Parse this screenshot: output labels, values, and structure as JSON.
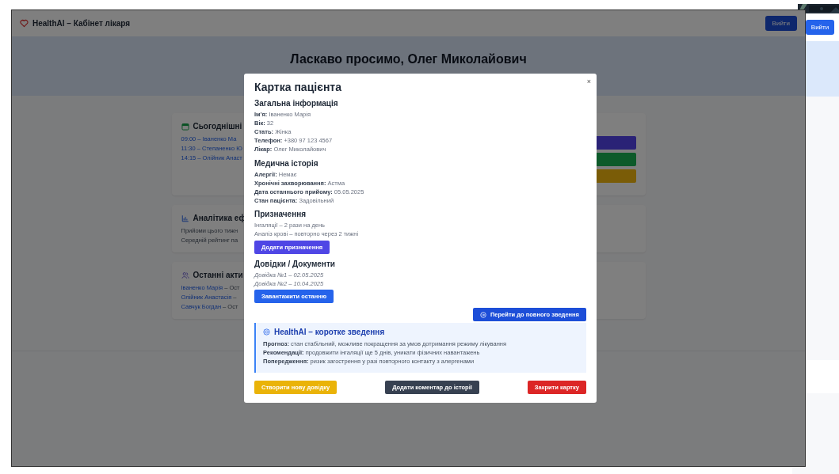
{
  "window": {
    "title": "HealthAI – Кабінет лікаря",
    "logout": "Вийти"
  },
  "hero": {
    "title": "Ласкаво просимо, Олег Миколайович"
  },
  "cards": [
    {
      "title": "Сьогоднішні",
      "items": [
        {
          "kind": "link",
          "text": "09:00 – Іваненко Ма"
        },
        {
          "kind": "link",
          "text": "11:30 – Степаненко Ю"
        },
        {
          "kind": "link",
          "text": "14:15 – Олійник Анаст"
        }
      ],
      "actions": [
        {
          "color": "#2a2276"
        },
        {
          "color": "#0d5a2a"
        },
        {
          "color": "#7a5c07"
        }
      ]
    },
    {
      "title": "Аналітика еф",
      "items": [
        {
          "kind": "plain",
          "text": "Прийоми цього тижн"
        },
        {
          "kind": "plain",
          "text": "Середній рейтинг па"
        }
      ]
    },
    {
      "title": "Останні акти",
      "items": [
        {
          "kind": "person",
          "name": "Іваненко Марія",
          "rest": "– Ост"
        },
        {
          "kind": "person",
          "name": "Олійник Анастасія",
          "rest": "–"
        },
        {
          "kind": "person",
          "name": "Савчук Богдан",
          "rest": "– Ост"
        }
      ]
    }
  ],
  "modal": {
    "title": "Картка пацієнта",
    "close": "×",
    "sections": [
      {
        "heading": "Загальна інформація",
        "kind": "fields",
        "fields": [
          {
            "label": "Ім'я:",
            "value": "Іваненко Марія"
          },
          {
            "label": "Вік:",
            "value": "32"
          },
          {
            "label": "Стать:",
            "value": "Жінка"
          },
          {
            "label": "Телефон:",
            "value": "+380 97 123 4567"
          },
          {
            "label": "Лікар:",
            "value": "Олег Миколайович"
          }
        ]
      },
      {
        "heading": "Медична історія",
        "kind": "fields",
        "fields": [
          {
            "label": "Алергії:",
            "value": "Немає"
          },
          {
            "label": "Хронічні захворювання:",
            "value": "Астма"
          },
          {
            "label": "Дата останнього прийому:",
            "value": "05.05.2025"
          },
          {
            "label": "Стан пацієнта:",
            "value": "Задовільний"
          }
        ]
      },
      {
        "heading": "Призначення",
        "kind": "lines",
        "lines": [
          "Інгаляції – 2 рази на день",
          "Аналіз крові – повторно через 2 тижні"
        ],
        "button": {
          "label": "Додати призначення",
          "color": "#4f46e5"
        }
      },
      {
        "heading": "Довідки / Документи",
        "kind": "docs",
        "lines": [
          "Довідка №1 – 02.05.2025",
          "Довідка №2 – 10.04.2025"
        ],
        "button": {
          "label": "Завантажити останню",
          "color": "#2563eb"
        }
      }
    ],
    "summary_button": "Перейти до повного зведення",
    "summary": {
      "title": "HealthAI – коротке зведення",
      "fields": [
        {
          "label": "Прогноз:",
          "value": "стан стабільний, можливе покращення за умов дотримання режиму лікування"
        },
        {
          "label": "Рекомендації:",
          "value": "продовжити інгаляції ще 5 днів, уникати фізичних навантажень"
        },
        {
          "label": "Попередження:",
          "value": "ризик загострення у разі повторного контакту з алергенами"
        }
      ]
    },
    "footer": [
      {
        "label": "Створити нову довідку",
        "color": "#eab308"
      },
      {
        "label": "Додати коментар до історії",
        "color": "#374151"
      },
      {
        "label": "Закрити картку",
        "color": "#dc2626"
      }
    ]
  },
  "background_window": {
    "logout": "Вийти"
  }
}
